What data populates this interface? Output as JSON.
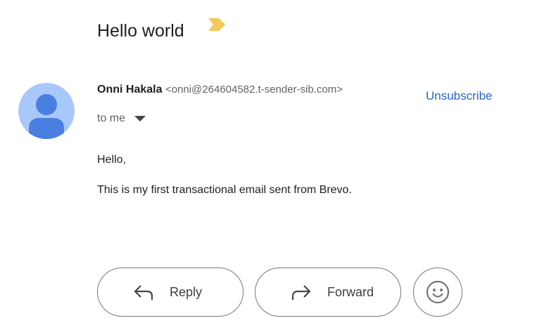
{
  "email": {
    "subject": "Hello world",
    "sender": {
      "name": "Onni Hakala",
      "email": "<onni@264604582.t-sender-sib.com>"
    },
    "recipient_label": "to me",
    "unsubscribe_label": "Unsubscribe",
    "body": {
      "greeting": "Hello,",
      "text": "This is my first transactional email sent from Brevo."
    }
  },
  "actions": {
    "reply_label": "Reply",
    "forward_label": "Forward"
  },
  "icons": {
    "importance": "importance-marker-icon",
    "avatar": "default-avatar",
    "caret": "caret-down-icon",
    "reply": "reply-icon",
    "forward": "forward-icon",
    "emoji": "emoji-reaction-icon"
  },
  "colors": {
    "importance_marker": "#f2c85b",
    "avatar_bg": "#a8c7fa",
    "avatar_figure": "#4a7fe0",
    "link": "#2962c9"
  }
}
